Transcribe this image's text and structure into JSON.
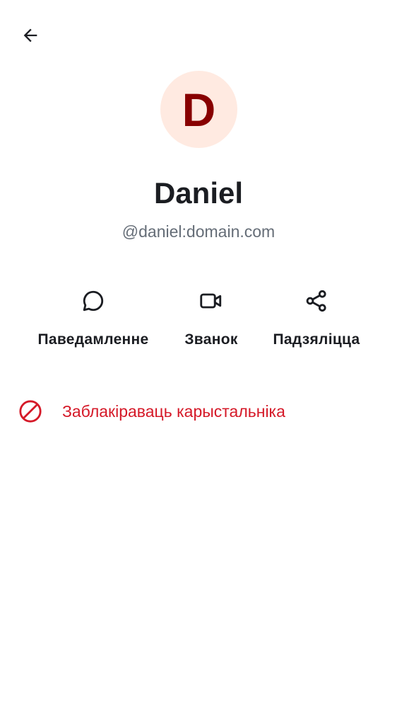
{
  "header": {
    "back_icon": "arrow-left-icon"
  },
  "profile": {
    "avatar_initial": "D",
    "display_name": "Daniel",
    "user_id": "@daniel:domain.com",
    "avatar_bg_color": "#ffeae1",
    "avatar_text_color": "#880000"
  },
  "actions": [
    {
      "label": "Паведамленне",
      "icon": "chat-bubble-icon"
    },
    {
      "label": "Званок",
      "icon": "video-camera-icon"
    },
    {
      "label": "Падзяліцца",
      "icon": "share-icon"
    }
  ],
  "block": {
    "label": "Заблакіраваць карыстальніка",
    "icon": "block-icon",
    "color": "#d51928"
  }
}
